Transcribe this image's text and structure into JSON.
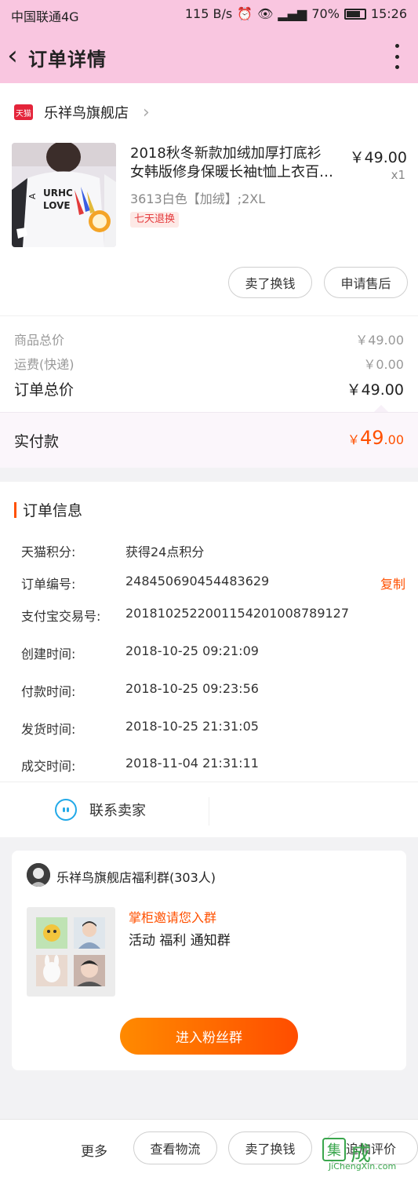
{
  "status_bar": {
    "carrier": "中国联通4G",
    "speed": "115 B/s",
    "battery": "70%",
    "time": "15:26"
  },
  "header": {
    "title": "订单详情"
  },
  "shop": {
    "badge": "天猫",
    "name": "乐祥鸟旗舰店"
  },
  "product": {
    "title_line1": "2018秋冬新款加绒加厚打底衫",
    "title_line2": "女韩版修身保暖长袖t恤上衣百…",
    "price": "￥49.00",
    "quantity": "x1",
    "sku": "3613白色【加绒】;2XL",
    "tag": "七天退换"
  },
  "actions": {
    "sell_for_cash": "卖了换钱",
    "after_sales": "申请售后"
  },
  "summary": {
    "goods_label": "商品总价",
    "goods_value": "￥49.00",
    "shipping_label": "运费(快递)",
    "shipping_value": "￥0.00",
    "total_label": "订单总价",
    "total_value": "￥49.00",
    "paid_label": "实付款",
    "paid_currency": "￥",
    "paid_int": "49",
    "paid_dec": ".00"
  },
  "order_info": {
    "title": "订单信息",
    "rows": [
      {
        "label": "天猫积分:",
        "value": "获得24点积分"
      },
      {
        "label": "订单编号:",
        "value": "248450690454483629"
      },
      {
        "label": "支付宝交易号:",
        "value": "2018102522001154201008789127"
      },
      {
        "label": "创建时间:",
        "value": "2018-10-25 09:21:09"
      },
      {
        "label": "付款时间:",
        "value": "2018-10-25 09:23:56"
      },
      {
        "label": "发货时间:",
        "value": "2018-10-25 21:31:05"
      },
      {
        "label": "成交时间:",
        "value": "2018-11-04 21:31:11"
      }
    ],
    "copy_label": "复制",
    "contact_seller": "联系卖家"
  },
  "group": {
    "name": "乐祥鸟旗舰店福利群(303人)",
    "invite": "掌柜邀请您入群",
    "tags": "活动  福利  通知群",
    "join_button": "进入粉丝群"
  },
  "bottom_bar": {
    "more": "更多",
    "logistics": "查看物流",
    "sell_for_cash": "卖了换钱",
    "add_review": "追加评价"
  },
  "watermark": {
    "logo": "集",
    "name": "成",
    "site": "JiChengXin.com"
  },
  "colors": {
    "header_bg": "#f9c6e0",
    "accent": "#ff5000",
    "tmall_red": "#e4243a",
    "contact_blue": "#22a9e8"
  }
}
